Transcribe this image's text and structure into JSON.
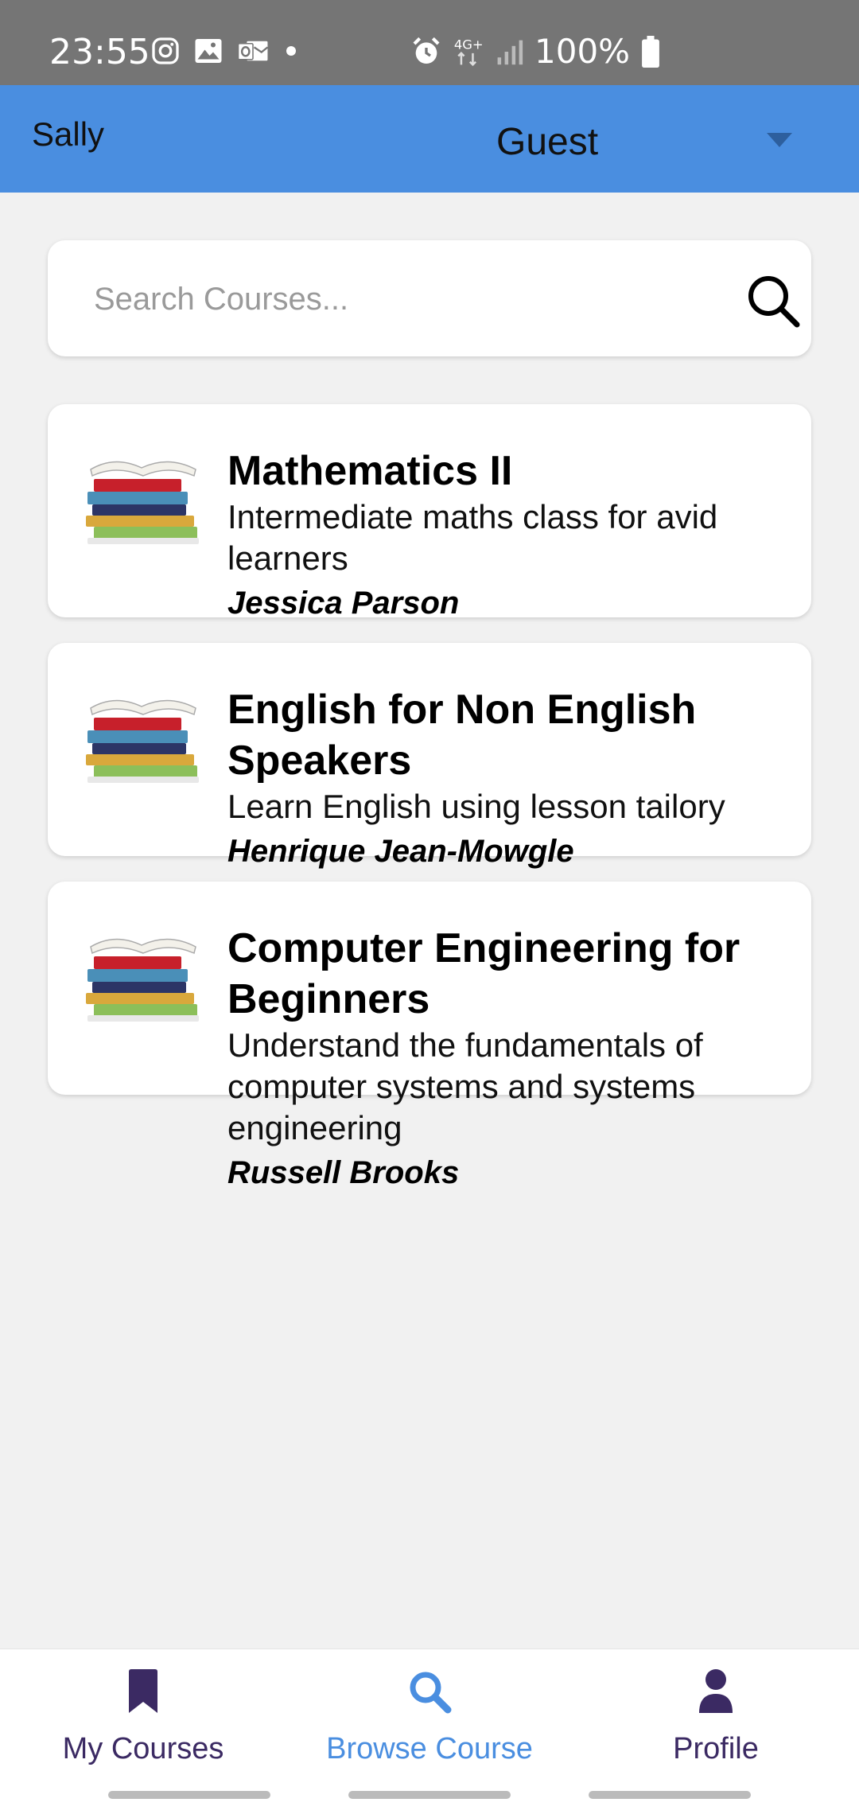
{
  "status_bar": {
    "time": "23:55",
    "battery": "100%",
    "network": "4G+"
  },
  "header": {
    "user": "Sally",
    "role": "Guest"
  },
  "search": {
    "placeholder": "Search Courses..."
  },
  "courses": [
    {
      "title": "Mathematics II",
      "description": "Intermediate maths class for avid learners",
      "author": "Jessica Parson"
    },
    {
      "title": "English for Non English Speakers",
      "description": "Learn English using lesson tailory",
      "author": "Henrique Jean-Mowgle"
    },
    {
      "title": "Computer Engineering for Beginners",
      "description": "Understand the fundamentals of computer systems and systems engineering",
      "author": "Russell Brooks"
    }
  ],
  "nav": {
    "my_courses": "My Courses",
    "browse_course": "Browse Course",
    "profile": "Profile"
  },
  "colors": {
    "header": "#4a8ee0",
    "nav_active": "#4a8ee0",
    "nav_inactive": "#3b2a63"
  }
}
